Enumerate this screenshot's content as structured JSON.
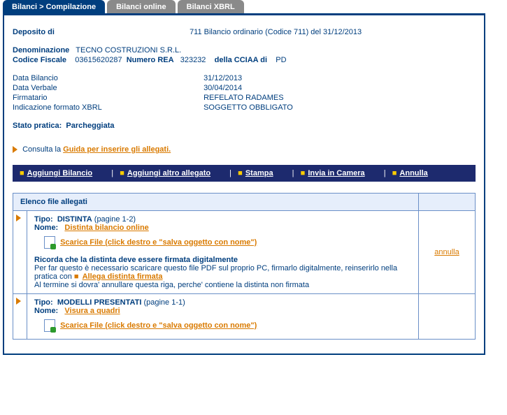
{
  "tabs": {
    "t1": "Bilanci > Compilazione",
    "t2": "Bilanci online",
    "t3": "Bilanci XBRL"
  },
  "deposito_label": "Deposito di",
  "deposito_val": "711 Bilancio ordinario (Codice 711) del 31/12/2013",
  "denom_label": "Denominazione",
  "denom_val": "TECNO COSTRUZIONI S.R.L.",
  "cf_label": "Codice Fiscale",
  "cf_val": "03615620287",
  "rea_label": "Numero REA",
  "rea_val": "323232",
  "cciaa_label": "della CCIAA di",
  "cciaa_val": "PD",
  "data_bil_label": "Data Bilancio",
  "data_bil_val": "31/12/2013",
  "data_verb_label": "Data Verbale",
  "data_verb_val": "30/04/2014",
  "firm_label": "Firmatario",
  "firm_val": "REFELATO RADAMES",
  "xbrl_label": "Indicazione formato XBRL",
  "xbrl_val": "SOGGETTO OBBLIGATO",
  "stato_label": "Stato pratica:",
  "stato_val": "Parcheggiata",
  "consulta_prefix": "Consulta la ",
  "consulta_link": "Guida per inserire gli allegati.",
  "actions": {
    "a1": "Aggiungi Bilancio",
    "a2": "Aggiungi altro allegato",
    "a3": "Stampa",
    "a4": "Invia in Camera",
    "a5": "Annulla"
  },
  "table_header": "Elenco file allegati",
  "row1": {
    "tipo_label": "Tipo:",
    "tipo_val": "DISTINTA",
    "pagine": "(pagine 1-2)",
    "nome_label": "Nome:",
    "nome_link": "Distinta bilancio online",
    "scarica": "Scarica File (click destro e \"salva oggetto con nome\")",
    "ricorda": "Ricorda che la distinta deve essere firmata digitalmente",
    "note1": "Per far questo è necessario scaricare questo file PDF sul proprio PC, firmarlo digitalmente, reinserirlo nella pratica con ",
    "allega_link": "Allega distinta firmata",
    "note2": "Al termine si dovra' annullare questa riga, perche' contiene la distinta non firmata",
    "annulla": "annulla"
  },
  "row2": {
    "tipo_label": "Tipo:",
    "tipo_val": "MODELLI PRESENTATI",
    "pagine": "(pagine 1-1)",
    "nome_label": "Nome:",
    "nome_link": "Visura a quadri",
    "scarica": "Scarica File (click destro e \"salva oggetto con nome\")"
  }
}
